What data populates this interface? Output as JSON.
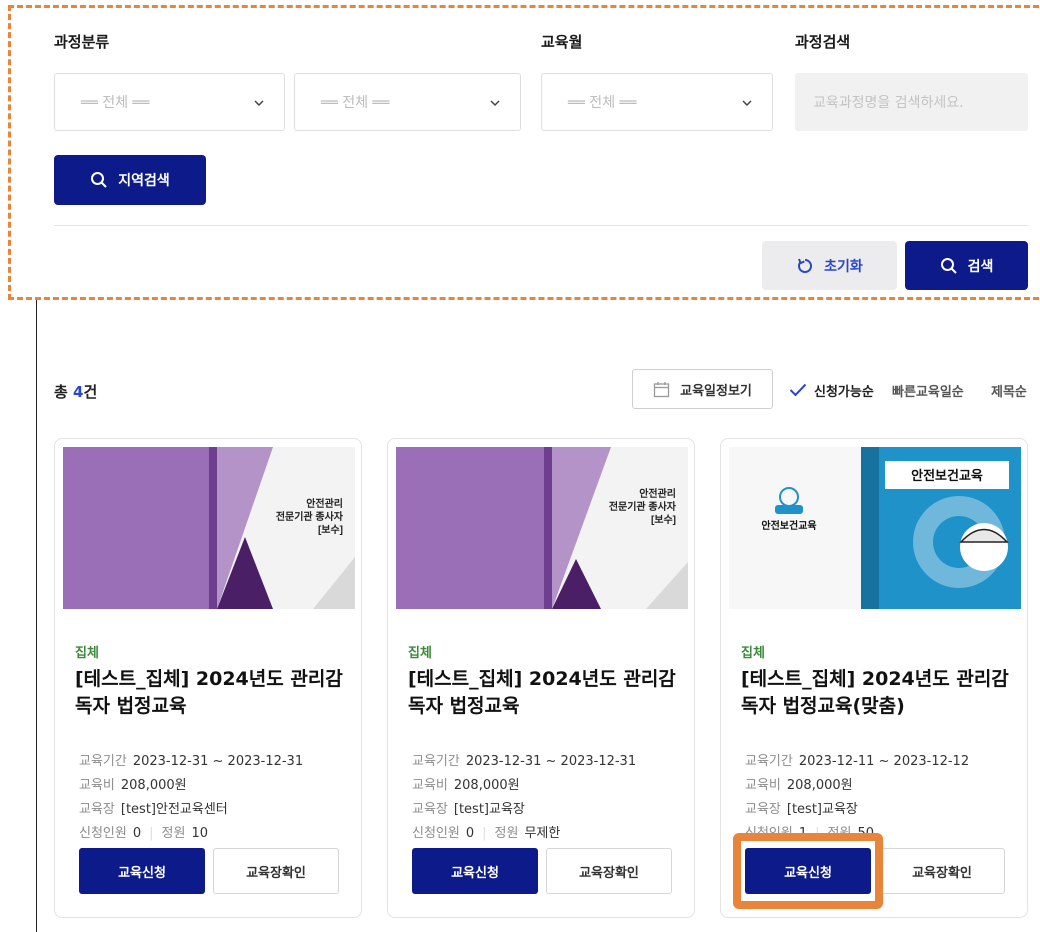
{
  "filters": {
    "category_label": "과정분류",
    "month_label": "교육월",
    "search_label": "과정검색",
    "select1": "══ 전체 ══",
    "select2": "══ 전체 ══",
    "select3": "══ 전체 ══",
    "search_placeholder": "교육과정명을 검색하세요.",
    "region_button": "지역검색",
    "reset_button": "초기화",
    "search_button": "검색"
  },
  "results": {
    "total_prefix": "총",
    "total_count": "4",
    "total_suffix": "건",
    "schedule_button": "교육일정보기",
    "sort_options": [
      "신청가능순",
      "빠른교육일순",
      "제목순"
    ]
  },
  "colors": {
    "navy": "#0d1b8a",
    "accent_blue": "#2a46c8",
    "badge_green": "#3a8a3a",
    "highlight_orange": "#e8853a"
  },
  "cards": [
    {
      "thumb_title": "안전관리\n전문기관 종사자\n[보수]",
      "badge": "집체",
      "title": "[테스트_집체] 2024년도 관리감독자 법정교육",
      "period_label": "교육기간",
      "period": "2023-12-31 ~ 2023-12-31",
      "fee_label": "교육비",
      "fee": "208,000원",
      "venue_label": "교육장",
      "venue": "[test]안전교육센터",
      "applicants_label": "신청인원",
      "applicants": "0",
      "capacity_label": "정원",
      "capacity": "10",
      "apply_button": "교육신청",
      "venue_button": "교육장확인"
    },
    {
      "thumb_title": "안전관리\n전문기관 종사자\n[보수]",
      "badge": "집체",
      "title": "[테스트_집체] 2024년도 관리감독자 법정교육",
      "period_label": "교육기간",
      "period": "2023-12-31 ~ 2023-12-31",
      "fee_label": "교육비",
      "fee": "208,000원",
      "venue_label": "교육장",
      "venue": "[test]교육장",
      "applicants_label": "신청인원",
      "applicants": "0",
      "capacity_label": "정원",
      "capacity": "무제한",
      "apply_button": "교육신청",
      "venue_button": "교육장확인"
    },
    {
      "thumb_title": "안전보건교육",
      "badge": "집체",
      "title": "[테스트_집체] 2024년도 관리감독자 법정교육(맞춤)",
      "period_label": "교육기간",
      "period": "2023-12-11 ~ 2023-12-12",
      "fee_label": "교육비",
      "fee": "208,000원",
      "venue_label": "교육장",
      "venue": "[test]교육장",
      "applicants_label": "신청인원",
      "applicants": "1",
      "capacity_label": "정원",
      "capacity": "50",
      "apply_button": "교육신청",
      "venue_button": "교육장확인"
    }
  ]
}
